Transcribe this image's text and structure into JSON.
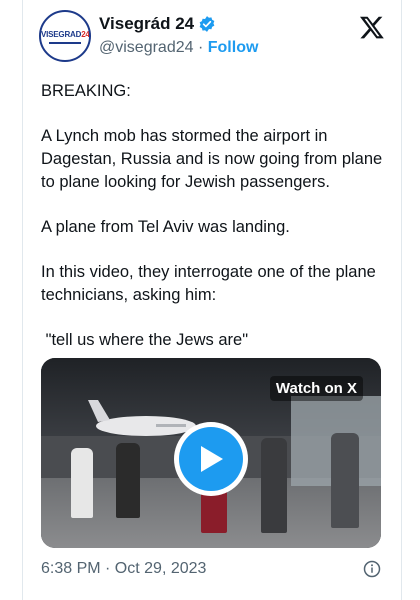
{
  "author": {
    "display_name": "Visegrád 24",
    "handle": "@visegrad24",
    "separator": "·",
    "follow_label": "Follow",
    "avatar_logo_text": "VISEGRAD",
    "avatar_logo_num": "24"
  },
  "post": {
    "paragraphs": [
      "BREAKING:",
      "A Lynch mob has stormed the airport in Dagestan, Russia and is now going from plane to plane looking for Jewish passengers.",
      "A plane from Tel Aviv was landing.",
      "In this video, they interrogate one of the plane technicians, asking him:",
      " \"tell us where the Jews are\""
    ],
    "media": {
      "watch_label": "Watch on X"
    },
    "timestamp": "6:38 PM · Oct 29, 2023"
  },
  "colors": {
    "accent": "#1d9bf0",
    "text_primary": "#0f1419",
    "text_secondary": "#536471"
  },
  "icons": {
    "verified": "verified-badge-icon",
    "platform": "x-logo-icon",
    "play": "play-icon",
    "info": "info-icon"
  }
}
